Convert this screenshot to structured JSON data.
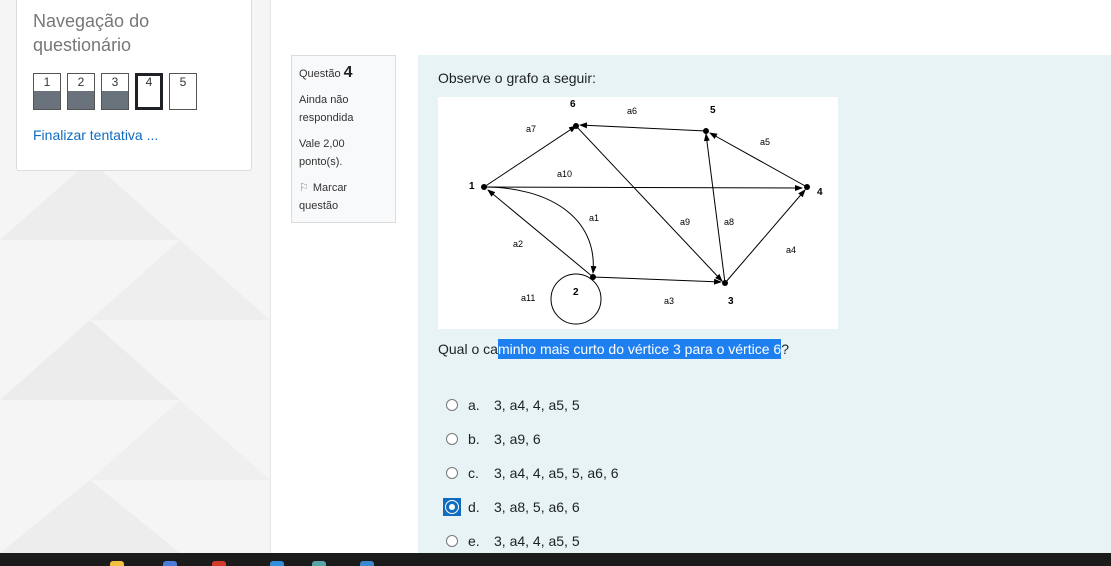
{
  "navigation": {
    "title": "Navegação do questionário",
    "questions": [
      {
        "label": "1",
        "answered": true,
        "current": false
      },
      {
        "label": "2",
        "answered": true,
        "current": false
      },
      {
        "label": "3",
        "answered": true,
        "current": false
      },
      {
        "label": "4",
        "answered": false,
        "current": true
      },
      {
        "label": "5",
        "answered": false,
        "current": false
      }
    ],
    "finalize_label": "Finalizar tentativa ..."
  },
  "question_info": {
    "prefix": "Questão",
    "number": "4",
    "status": "Ainda não respondida",
    "grade": "Vale 2,00 ponto(s).",
    "flag_label": "Marcar questão"
  },
  "question": {
    "intro": "Observe o grafo a seguir:",
    "text_before": "Qual o ca",
    "text_selected": "minho mais curto do vértice 3 para o vértice 6",
    "text_after": "?",
    "answers": [
      {
        "letter": "a.",
        "text": "3, a4, 4, a5, 5",
        "selected": false
      },
      {
        "letter": "b.",
        "text": "3, a9, 6",
        "selected": false
      },
      {
        "letter": "c.",
        "text": "3, a4, 4, a5, 5, a6, 6",
        "selected": false
      },
      {
        "letter": "d.",
        "text": "3, a8, 5, a6, 6",
        "selected": true
      },
      {
        "letter": "e.",
        "text": "3, a4, 4, a5, 5",
        "selected": false
      }
    ]
  },
  "graph": {
    "vertices": [
      "1",
      "2",
      "3",
      "4",
      "5",
      "6"
    ],
    "edges": [
      "a1",
      "a2",
      "a3",
      "a4",
      "a5",
      "a6",
      "a7",
      "a8",
      "a9",
      "a10",
      "a11"
    ]
  },
  "colors": {
    "link": "#0f6cbf",
    "selection": "#1e80f0",
    "content_bg": "#e7f3f5"
  }
}
